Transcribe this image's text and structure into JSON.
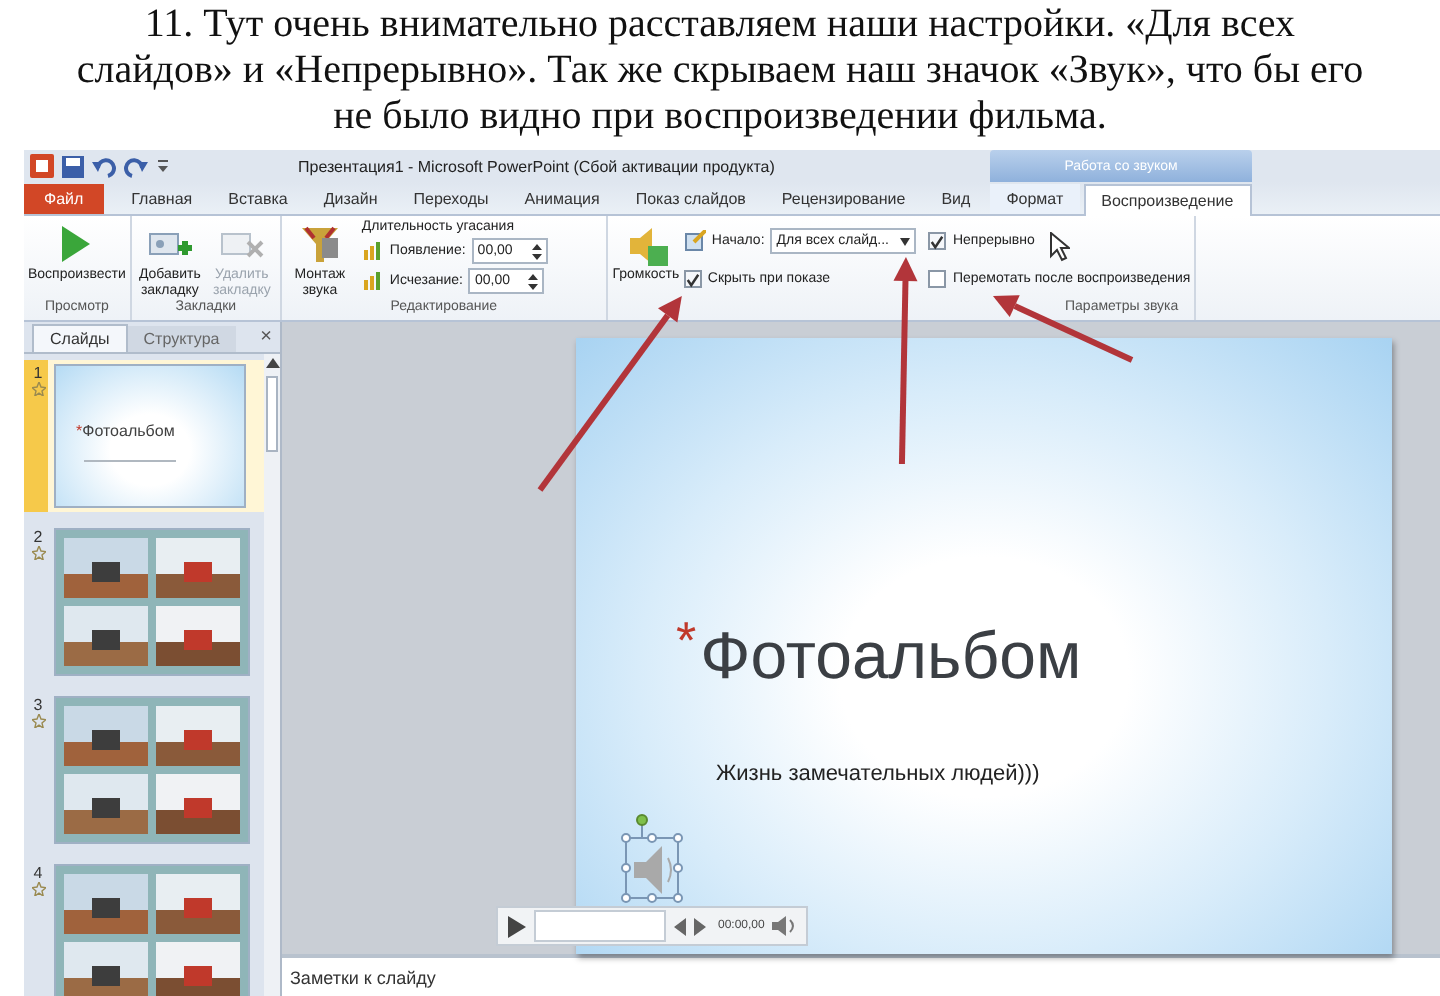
{
  "caption": "11. Тут очень внимательно расставляем наши настройки. «Для всех слайдов» и «Непрерывно». Так же скрываем наш значок «Звук», что бы его не было видно при воспроизведении фильма.",
  "window": {
    "title": "Презентация1 - Microsoft PowerPoint (Сбой активации продукта)",
    "context_group": "Работа со звуком"
  },
  "tabs": [
    {
      "label": "Файл",
      "kind": "file",
      "selected": false
    },
    {
      "label": "Главная",
      "kind": "normal",
      "selected": false
    },
    {
      "label": "Вставка",
      "kind": "normal",
      "selected": false
    },
    {
      "label": "Дизайн",
      "kind": "normal",
      "selected": false
    },
    {
      "label": "Переходы",
      "kind": "normal",
      "selected": false
    },
    {
      "label": "Анимация",
      "kind": "normal",
      "selected": false
    },
    {
      "label": "Показ слайдов",
      "kind": "normal",
      "selected": false
    },
    {
      "label": "Рецензирование",
      "kind": "normal",
      "selected": false
    },
    {
      "label": "Вид",
      "kind": "normal",
      "selected": false
    },
    {
      "label": "Формат",
      "kind": "contextual",
      "selected": false
    },
    {
      "label": "Воспроизведение",
      "kind": "contextual",
      "selected": true
    }
  ],
  "ribbon_groups": [
    {
      "label": "Просмотр",
      "items": [
        {
          "kind": "big",
          "label": "Воспроизвести",
          "disabled": false
        }
      ]
    },
    {
      "label": "Закладки",
      "items": [
        {
          "kind": "big",
          "label": "Добавить закладку",
          "disabled": false
        },
        {
          "kind": "big",
          "label": "Удалить закладку",
          "disabled": true
        }
      ]
    },
    {
      "label": "Редактирование",
      "items": [
        {
          "kind": "big",
          "label": "Монтаж звука",
          "disabled": false
        },
        {
          "kind": "fade",
          "title": "Длительность угасания",
          "rows": [
            {
              "label": "Появление:",
              "value": "00,00"
            },
            {
              "label": "Исчезание:",
              "value": "00,00"
            }
          ]
        }
      ]
    },
    {
      "label": "Параметры звука",
      "items": [
        {
          "kind": "big",
          "label": "Громкость",
          "disabled": false
        },
        {
          "kind": "options",
          "start_label": "Начало:",
          "start_value": "Для всех слайд...",
          "checks": [
            {
              "label": "Непрерывно",
              "checked": true
            },
            {
              "label": "Скрыть при показе",
              "checked": true
            },
            {
              "label": "Перемотать после воспроизведения",
              "checked": false
            }
          ]
        }
      ]
    }
  ],
  "slide_pane": {
    "tabs": [
      {
        "label": "Слайды",
        "selected": true
      },
      {
        "label": "Структура",
        "selected": false
      }
    ],
    "close": "×",
    "slides": [
      {
        "number": "1",
        "kind": "title",
        "title": "Фотоальбом",
        "selected": true
      },
      {
        "number": "2",
        "kind": "picture",
        "selected": false
      },
      {
        "number": "3",
        "kind": "picture",
        "selected": false
      },
      {
        "number": "4",
        "kind": "picture",
        "selected": false
      }
    ]
  },
  "slide": {
    "title_mark": "*",
    "title": "Фотоальбом",
    "subtitle": "Жизнь замечательных людей)))",
    "player_time": "00:00,00"
  },
  "notes": {
    "placeholder": "Заметки к слайду"
  }
}
